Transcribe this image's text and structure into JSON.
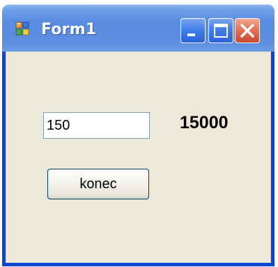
{
  "window": {
    "title": "Form1",
    "icon": "form-app-icon",
    "controls": {
      "minimize_icon": "minimize-icon",
      "maximize_icon": "maximize-icon",
      "close_icon": "close-icon"
    }
  },
  "form": {
    "input_value": "150",
    "result_label": "15000",
    "button_label": "konec"
  },
  "colors": {
    "titlebar": "#5a8be0",
    "frame": "#0a46d6",
    "client_bg": "#ece9d8",
    "close_button": "#e27358"
  }
}
